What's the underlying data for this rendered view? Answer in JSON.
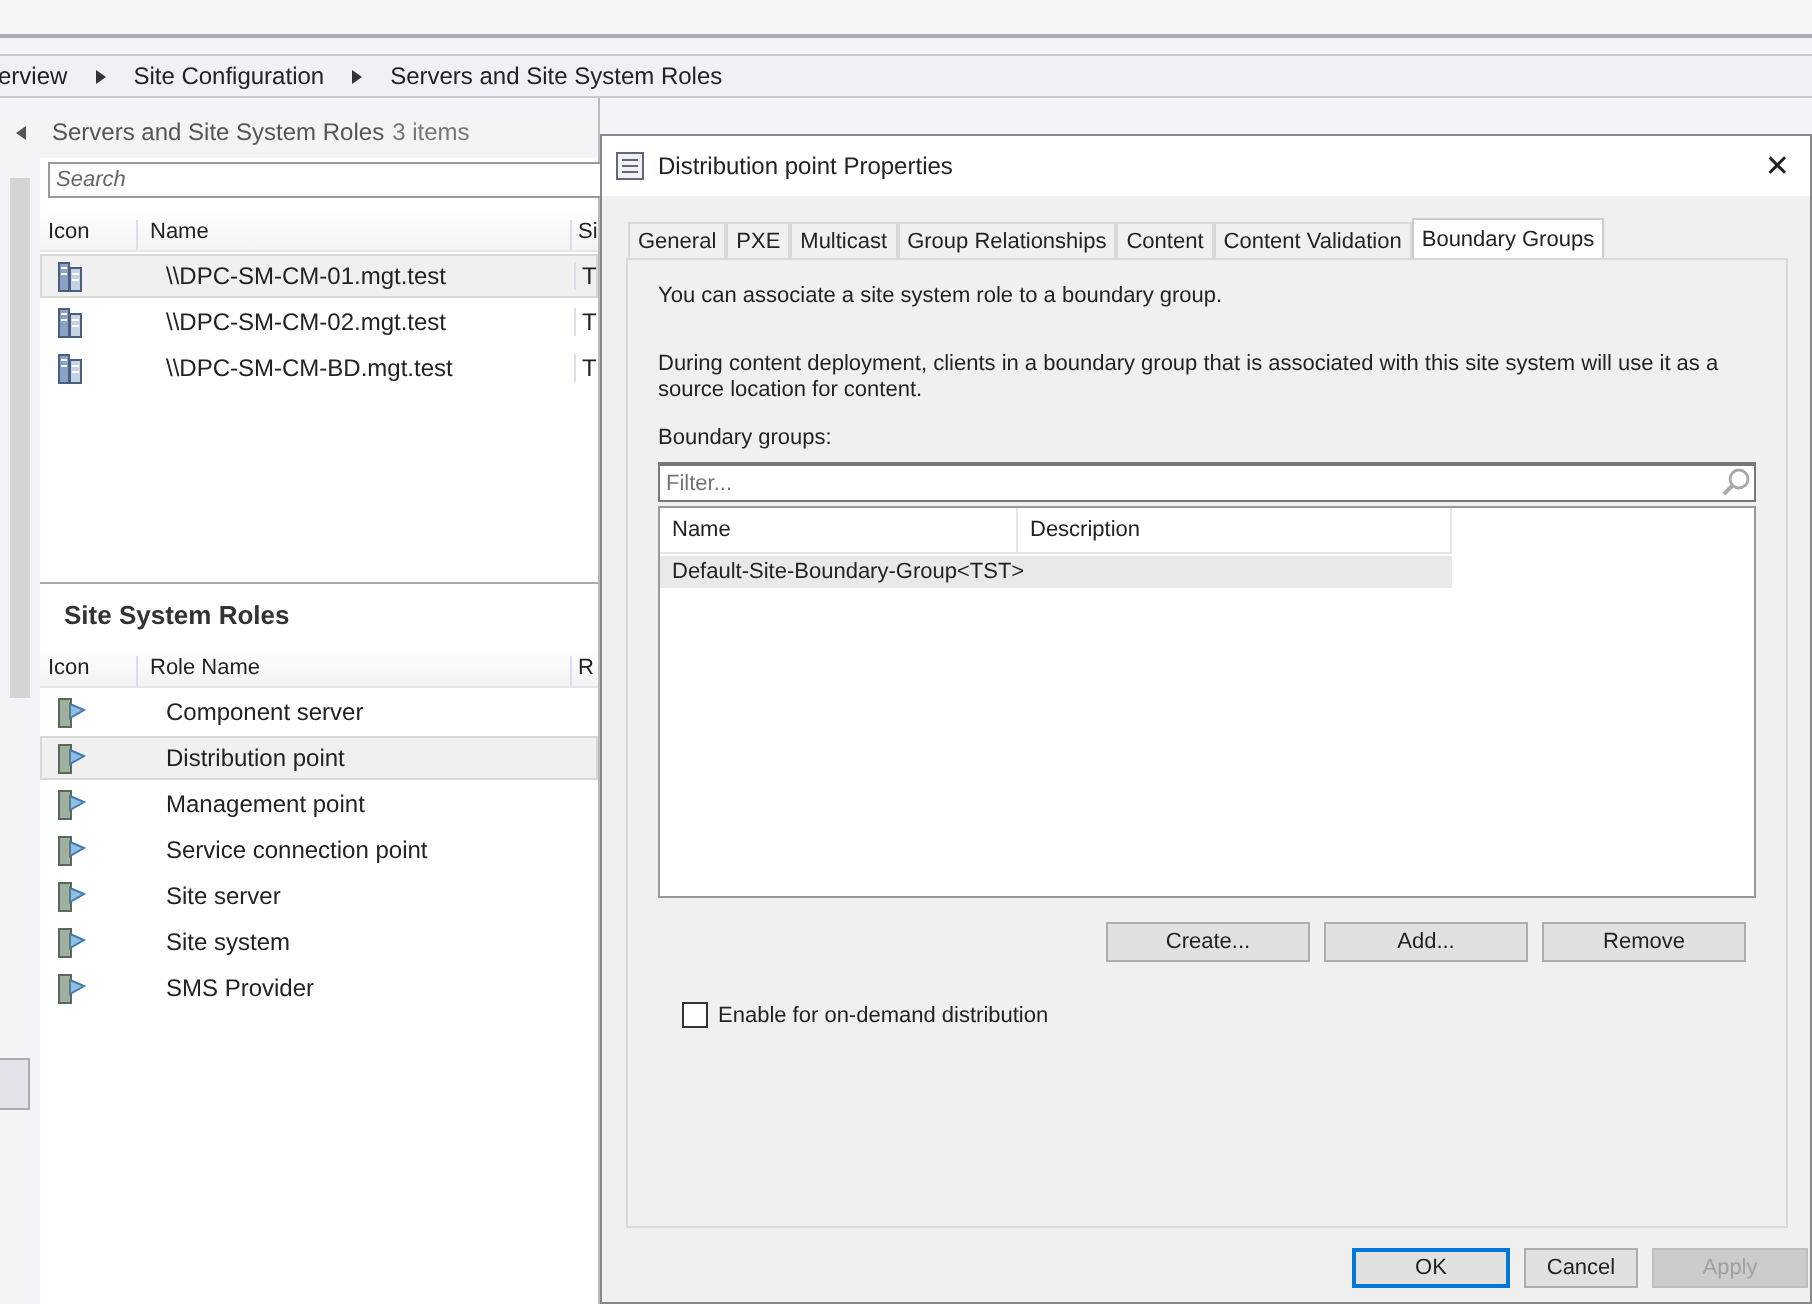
{
  "breadcrumb": [
    {
      "label": "erview"
    },
    {
      "label": "Site Configuration"
    },
    {
      "label": "Servers and Site System Roles"
    }
  ],
  "servers_pane": {
    "title": "Servers and Site System Roles",
    "count": "3 items",
    "search": {
      "placeholder": "Search"
    },
    "columns": [
      "Icon",
      "Name",
      "Si"
    ],
    "rows": [
      {
        "name": "\\\\DPC-SM-CM-01.mgt.test",
        "column_3": "T",
        "selected": true
      },
      {
        "name": "\\\\DPC-SM-CM-02.mgt.test",
        "column_3": "T",
        "selected": false
      },
      {
        "name": "\\\\DPC-SM-CM-BD.mgt.test",
        "column_3": "T",
        "selected": false
      }
    ]
  },
  "roles_pane": {
    "title": "Site System Roles",
    "columns": [
      "Icon",
      "Role Name",
      "R"
    ],
    "rows": [
      {
        "name": "Component server",
        "selected": false
      },
      {
        "name": "Distribution point",
        "selected": true
      },
      {
        "name": "Management point",
        "selected": false
      },
      {
        "name": "Service connection point",
        "selected": false
      },
      {
        "name": "Site server",
        "selected": false
      },
      {
        "name": "Site system",
        "selected": false
      },
      {
        "name": "SMS Provider",
        "selected": false
      }
    ]
  },
  "dialog": {
    "title": "Distribution point Properties",
    "close": "✕",
    "tabs": [
      {
        "label": "General",
        "selected": false
      },
      {
        "label": "PXE",
        "selected": false
      },
      {
        "label": "Multicast",
        "selected": false
      },
      {
        "label": "Group Relationships",
        "selected": false
      },
      {
        "label": "Content",
        "selected": false
      },
      {
        "label": "Content Validation",
        "selected": false
      },
      {
        "label": "Boundary Groups",
        "selected": true
      }
    ],
    "intro": "You can associate a site system role to a boundary group.",
    "description": "During content deployment, clients in a boundary group that is associated with this site system will use it as a source location for content.",
    "boundary_groups_label": "Boundary groups:",
    "filter": {
      "placeholder": "Filter..."
    },
    "list_columns": [
      "Name",
      "Description"
    ],
    "list_rows": [
      {
        "name": "Default-Site-Boundary-Group<TST>",
        "selected": true
      }
    ],
    "list_buttons": [
      "Create...",
      "Add...",
      "Remove"
    ],
    "on_demand": {
      "label": "Enable for on-demand distribution",
      "checked": false
    },
    "footer_buttons": [
      {
        "label": "OK",
        "kind": "default",
        "disabled": false
      },
      {
        "label": "Cancel",
        "kind": "normal",
        "disabled": false
      },
      {
        "label": "Apply",
        "kind": "normal",
        "disabled": true
      }
    ]
  }
}
